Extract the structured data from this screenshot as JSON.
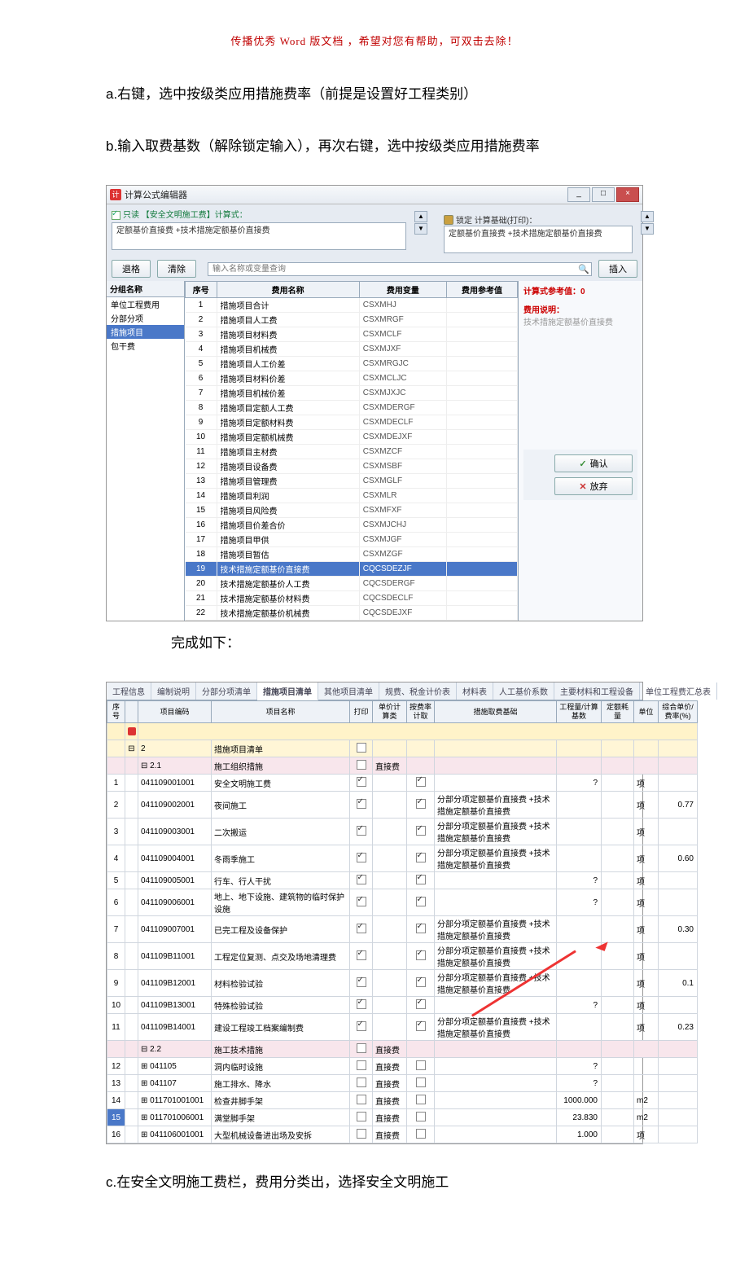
{
  "header_note": "传播优秀 Word 版文档 ，希望对您有帮助，可双击去除！",
  "para_a": "a.右键，选中按级类应用措施费率（前提是设置好工程类别）",
  "para_b": "b.输入取费基数（解除锁定输入），再次右键，选中按级类应用措施费率",
  "para_mid": "完成如下：",
  "para_c": "c.在安全文明施工费栏，费用分类出，选择安全文明施工",
  "dlg": {
    "title": "计算公式编辑器",
    "readonly": "只读 【安全文明施工费】计算式：",
    "formula": "定额基价直接费 +技术措施定额基价直接费",
    "lock_label": "锁定  计算基础(打印)：",
    "rformula": "定额基价直接费 +技术措施定额基价直接费",
    "btn_back": "退格",
    "btn_clear": "清除",
    "search_ph": "输入名称或变量查询",
    "btn_insert": "插入",
    "left_header": "分组名称",
    "left_items": [
      "单位工程费用",
      "分部分项",
      "措施项目",
      "包干费"
    ],
    "cols": [
      "序号",
      "费用名称",
      "费用变量",
      "费用参考值"
    ],
    "rows": [
      [
        "1",
        "措施项目合计",
        "CSXMHJ"
      ],
      [
        "2",
        "措施项目人工费",
        "CSXMRGF"
      ],
      [
        "3",
        "措施项目材料费",
        "CSXMCLF"
      ],
      [
        "4",
        "措施项目机械费",
        "CSXMJXF"
      ],
      [
        "5",
        "措施项目人工价差",
        "CSXMRGJC"
      ],
      [
        "6",
        "措施项目材料价差",
        "CSXMCLJC"
      ],
      [
        "7",
        "措施项目机械价差",
        "CSXMJXJC"
      ],
      [
        "8",
        "措施项目定额人工费",
        "CSXMDERGF"
      ],
      [
        "9",
        "措施项目定额材料费",
        "CSXMDECLF"
      ],
      [
        "10",
        "措施项目定额机械费",
        "CSXMDEJXF"
      ],
      [
        "11",
        "措施项目主材费",
        "CSXMZCF"
      ],
      [
        "12",
        "措施项目设备费",
        "CSXMSBF"
      ],
      [
        "13",
        "措施项目管理费",
        "CSXMGLF"
      ],
      [
        "14",
        "措施项目利润",
        "CSXMLR"
      ],
      [
        "15",
        "措施项目风险费",
        "CSXMFXF"
      ],
      [
        "16",
        "措施项目价差合价",
        "CSXMJCHJ"
      ],
      [
        "17",
        "措施项目甲供",
        "CSXMJGF"
      ],
      [
        "18",
        "措施项目暂估",
        "CSXMZGF"
      ],
      [
        "19",
        "技术措施定额基价直接费",
        "CQCSDEZJF"
      ],
      [
        "20",
        "技术措施定额基价人工费",
        "CQCSDERGF"
      ],
      [
        "21",
        "技术措施定额基价材料费",
        "CQCSDECLF"
      ],
      [
        "22",
        "技术措施定额基价机械费",
        "CQCSDEJXF"
      ]
    ],
    "calc_val": "计算式参考值：0",
    "usage_lbl": "费用说明：",
    "usage_desc": "技术措施定额基价直接费",
    "ok": "确认",
    "cancel": "放弃"
  },
  "shot2": {
    "tabs": [
      "工程信息",
      "编制说明",
      "分部分项清单",
      "措施项目清单",
      "其他项目清单",
      "规费、税金计价表",
      "材料表",
      "人工基价系数",
      "主要材料和工程设备",
      "单位工程费汇总表"
    ],
    "active_tab": 3,
    "headers": [
      "序号",
      "",
      "项目编码",
      "项目名称",
      "打印",
      "单价计算类",
      "按费率计取",
      "措施取费基础",
      "工程量/计算基数",
      "定额耗量",
      "单位",
      "综合单价/费率(%)"
    ],
    "rows": [
      {
        "cls": "yellowrow",
        "cols": [
          "",
          "⊟",
          "2",
          "措施项目清单",
          "□",
          "",
          "",
          "",
          "",
          "",
          "",
          ""
        ]
      },
      {
        "cls": "pinkrow",
        "cols": [
          "",
          "",
          "⊟ 2.1",
          "施工组织措施",
          "□",
          "直接费",
          "",
          "",
          "",
          "",
          "",
          ""
        ]
      },
      {
        "cls": "",
        "cols": [
          "1",
          "",
          "  041109001001",
          "安全文明施工费",
          "☑",
          "",
          "☑",
          "",
          "?",
          "",
          "项",
          ""
        ]
      },
      {
        "cls": "",
        "cols": [
          "2",
          "",
          "  041109002001",
          "夜间施工",
          "☑",
          "",
          "☑",
          "分部分项定额基价直接费 +技术措施定额基价直接费",
          "",
          "",
          "项",
          "0.77"
        ]
      },
      {
        "cls": "",
        "cols": [
          "3",
          "",
          "  041109003001",
          "二次搬运",
          "☑",
          "",
          "☑",
          "分部分项定额基价直接费 +技术措施定额基价直接费",
          "",
          "",
          "项",
          ""
        ]
      },
      {
        "cls": "",
        "cols": [
          "4",
          "",
          "  041109004001",
          "冬雨季施工",
          "☑",
          "",
          "☑",
          "分部分项定额基价直接费 +技术措施定额基价直接费",
          "",
          "",
          "项",
          "0.60"
        ]
      },
      {
        "cls": "",
        "cols": [
          "5",
          "",
          "  041109005001",
          "行车、行人干扰",
          "☑",
          "",
          "☑",
          "",
          "?",
          "",
          "项",
          ""
        ]
      },
      {
        "cls": "",
        "cols": [
          "6",
          "",
          "  041109006001",
          "地上、地下设施、建筑物的临时保护设施",
          "☑",
          "",
          "☑",
          "",
          "?",
          "",
          "项",
          ""
        ]
      },
      {
        "cls": "",
        "cols": [
          "7",
          "",
          "  041109007001",
          "已完工程及设备保护",
          "☑",
          "",
          "☑",
          "分部分项定额基价直接费 +技术措施定额基价直接费",
          "",
          "",
          "项",
          "0.30"
        ]
      },
      {
        "cls": "",
        "cols": [
          "8",
          "",
          "  041109B11001",
          "工程定位复测、点交及场地清理费",
          "☑",
          "",
          "☑",
          "分部分项定额基价直接费 +技术措施定额基价直接费",
          "",
          "",
          "项",
          ""
        ]
      },
      {
        "cls": "",
        "cols": [
          "9",
          "",
          "  041109B12001",
          "材料检验试验",
          "☑",
          "",
          "☑",
          "分部分项定额基价直接费 +技术措施定额基价直接费",
          "",
          "",
          "项",
          "0.1"
        ]
      },
      {
        "cls": "",
        "cols": [
          "10",
          "",
          "  041109B13001",
          "特殊检验试验",
          "☑",
          "",
          "☑",
          "",
          "?",
          "",
          "项",
          ""
        ]
      },
      {
        "cls": "",
        "cols": [
          "11",
          "",
          "  041109B14001",
          "建设工程竣工档案编制费",
          "☑",
          "",
          "☑",
          "分部分项定额基价直接费 +技术措施定额基价直接费",
          "",
          "",
          "项",
          "0.23"
        ]
      },
      {
        "cls": "pinkrow",
        "cols": [
          "",
          "",
          "⊟ 2.2",
          "施工技术措施",
          "□",
          "直接费",
          "",
          "",
          "",
          "",
          "",
          ""
        ]
      },
      {
        "cls": "",
        "cols": [
          "12",
          "",
          "⊞ 041105",
          "洞内临时设施",
          "□",
          "直接费",
          "□",
          "",
          "?",
          "",
          "",
          ""
        ]
      },
      {
        "cls": "",
        "cols": [
          "13",
          "",
          "⊞ 041107",
          "施工排水、降水",
          "□",
          "直接费",
          "□",
          "",
          "?",
          "",
          "",
          ""
        ]
      },
      {
        "cls": "",
        "cols": [
          "14",
          "",
          "⊞ 011701001001",
          "检查井脚手架",
          "□",
          "直接费",
          "□",
          "",
          "1000.000",
          "",
          "m2",
          ""
        ]
      },
      {
        "cls": "selrow",
        "cols": [
          "15",
          "",
          "⊞ 011701006001",
          "满堂脚手架",
          "□",
          "直接费",
          "□",
          "",
          "23.830",
          "",
          "m2",
          ""
        ]
      },
      {
        "cls": "",
        "cols": [
          "16",
          "",
          "⊞ 041106001001",
          "大型机械设备进出场及安拆",
          "□",
          "直接费",
          "□",
          "",
          "1.000",
          "",
          "项",
          ""
        ]
      }
    ]
  }
}
